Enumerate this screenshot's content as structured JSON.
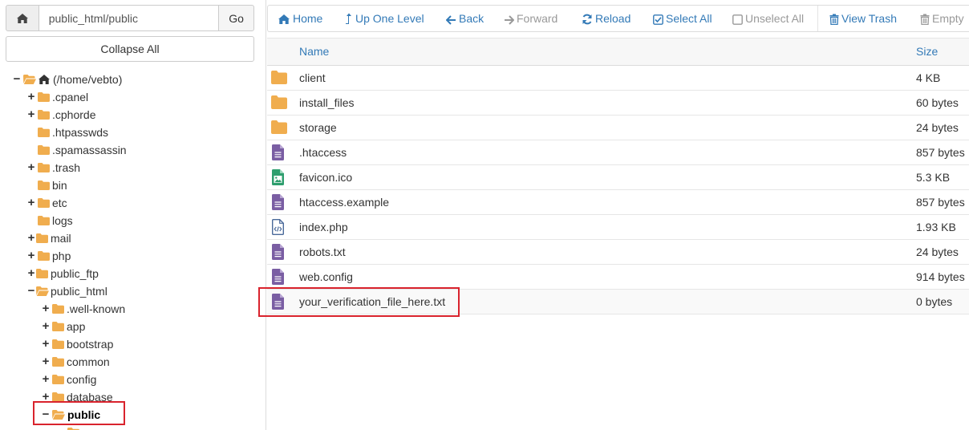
{
  "pathbar": {
    "path_value": "public_html/public",
    "go_label": "Go"
  },
  "collapse_label": "Collapse All",
  "toolbar": {
    "home": "Home",
    "up": "Up One Level",
    "back": "Back",
    "forward": "Forward",
    "reload": "Reload",
    "select_all": "Select All",
    "unselect_all": "Unselect All",
    "view_trash": "View Trash",
    "empty": "Empty"
  },
  "tree": {
    "root": "(/home/vebto)",
    "items": [
      ".cpanel",
      ".cphorde",
      ".htpasswds",
      ".spamassassin",
      ".trash",
      "bin",
      "etc",
      "logs",
      "mail",
      "php",
      "public_ftp",
      "public_html"
    ],
    "public_html_children": [
      ".well-known",
      "app",
      "bootstrap",
      "common",
      "config",
      "database",
      "public"
    ]
  },
  "table": {
    "headers": {
      "name": "Name",
      "size": "Size"
    },
    "rows": [
      {
        "name": "client",
        "size": "4 KB",
        "icon": "folder-icon"
      },
      {
        "name": "install_files",
        "size": "60 bytes",
        "icon": "folder-icon"
      },
      {
        "name": "storage",
        "size": "24 bytes",
        "icon": "folder-icon"
      },
      {
        "name": ".htaccess",
        "size": "857 bytes",
        "icon": "text-file-icon"
      },
      {
        "name": "favicon.ico",
        "size": "5.3 KB",
        "icon": "image-file-icon"
      },
      {
        "name": "htaccess.example",
        "size": "857 bytes",
        "icon": "text-file-icon"
      },
      {
        "name": "index.php",
        "size": "1.93 KB",
        "icon": "code-file-icon"
      },
      {
        "name": "robots.txt",
        "size": "24 bytes",
        "icon": "text-file-icon"
      },
      {
        "name": "web.config",
        "size": "914 bytes",
        "icon": "text-file-icon"
      },
      {
        "name": "your_verification_file_here.txt",
        "size": "0 bytes",
        "icon": "text-file-icon"
      }
    ]
  },
  "colors": {
    "link": "#337ab7",
    "folder": "#f0ad4e",
    "text_file": "#7a5ea3",
    "image_file": "#2e9e6e",
    "highlight": "#d9232d"
  }
}
